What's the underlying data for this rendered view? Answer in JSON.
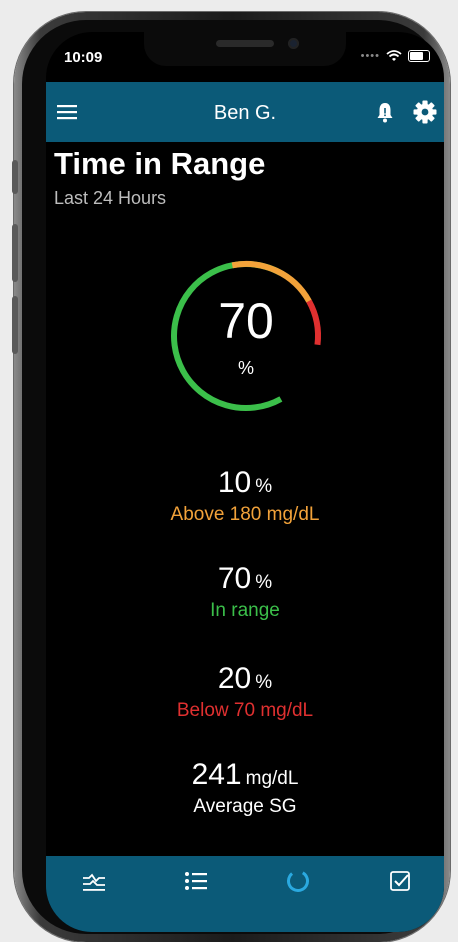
{
  "status": {
    "time": "10:09"
  },
  "header": {
    "title": "Ben G."
  },
  "page": {
    "title": "Time in Range",
    "subtitle": "Last 24 Hours"
  },
  "gauge": {
    "value": "70",
    "unit": "%",
    "segments": {
      "above": 10,
      "in_range": 70,
      "below": 20
    }
  },
  "stats": [
    {
      "value": "10",
      "unit": "%",
      "label": "Above 180 mg/dL",
      "color": "#f2a23a"
    },
    {
      "value": "70",
      "unit": "%",
      "label": "In range",
      "color": "#3bbf4a"
    },
    {
      "value": "20",
      "unit": "%",
      "label": "Below 70 mg/dL",
      "color": "#e03030"
    },
    {
      "value": "241",
      "unit": "mg/dL",
      "label": "Average SG",
      "color": "#ffffff"
    }
  ],
  "colors": {
    "accent": "#0b5a78",
    "above": "#f2a23a",
    "in_range": "#3bbf4a",
    "below": "#e03030"
  },
  "tabs": [
    {
      "icon": "sg-graph-icon"
    },
    {
      "icon": "list-icon"
    },
    {
      "icon": "time-in-range-icon",
      "active": true
    },
    {
      "icon": "checkbox-icon"
    }
  ]
}
